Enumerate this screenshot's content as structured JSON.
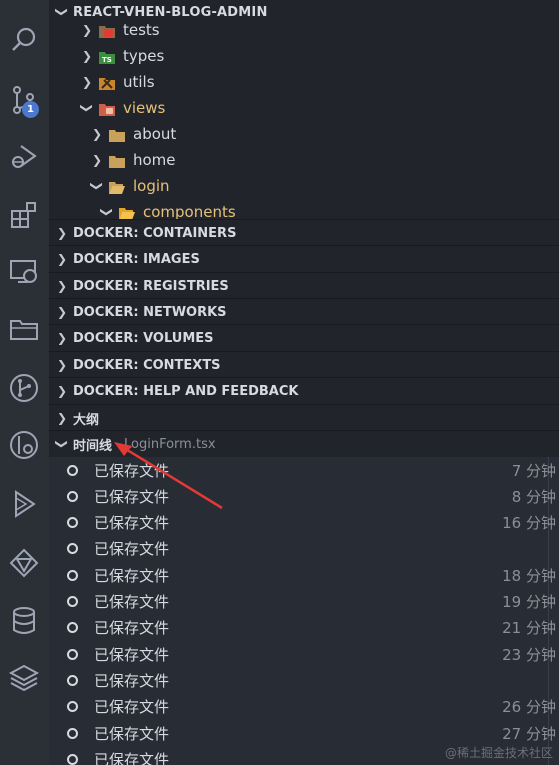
{
  "explorer": {
    "title": "REACT-VHEN-BLOG-ADMIN",
    "tree": [
      {
        "label": "tests",
        "icon": "tests-folder-icon",
        "expanded": false,
        "level": 0
      },
      {
        "label": "types",
        "icon": "typescript-folder-icon",
        "expanded": false,
        "level": 0
      },
      {
        "label": "utils",
        "icon": "utils-folder-icon",
        "expanded": false,
        "level": 0
      },
      {
        "label": "views",
        "icon": "views-folder-icon",
        "expanded": true,
        "level": 0,
        "modified": true
      },
      {
        "label": "about",
        "icon": "folder-icon",
        "expanded": false,
        "level": 1
      },
      {
        "label": "home",
        "icon": "folder-icon",
        "expanded": false,
        "level": 1
      },
      {
        "label": "login",
        "icon": "open-folder-icon",
        "expanded": true,
        "level": 1,
        "modified": true
      },
      {
        "label": "components",
        "icon": "components-folder-icon",
        "expanded": true,
        "level": 2,
        "modified": true
      }
    ]
  },
  "sections": [
    {
      "label": "DOCKER: CONTAINERS"
    },
    {
      "label": "DOCKER: IMAGES"
    },
    {
      "label": "DOCKER: REGISTRIES"
    },
    {
      "label": "DOCKER: NETWORKS"
    },
    {
      "label": "DOCKER: VOLUMES"
    },
    {
      "label": "DOCKER: CONTEXTS"
    },
    {
      "label": "DOCKER: HELP AND FEEDBACK"
    },
    {
      "label": "大纲"
    }
  ],
  "timeline": {
    "title": "时间线",
    "file": "LoginForm.tsx",
    "entries": [
      {
        "label": "已保存文件",
        "time": "7 分钟"
      },
      {
        "label": "已保存文件",
        "time": "8 分钟"
      },
      {
        "label": "已保存文件",
        "time": "16 分钟"
      },
      {
        "label": "已保存文件",
        "time": ""
      },
      {
        "label": "已保存文件",
        "time": "18 分钟"
      },
      {
        "label": "已保存文件",
        "time": "19 分钟"
      },
      {
        "label": "已保存文件",
        "time": "21 分钟"
      },
      {
        "label": "已保存文件",
        "time": "23 分钟"
      },
      {
        "label": "已保存文件",
        "time": ""
      },
      {
        "label": "已保存文件",
        "time": "26 分钟"
      },
      {
        "label": "已保存文件",
        "time": "27 分钟"
      },
      {
        "label": "已保存文件",
        "time": ""
      }
    ]
  },
  "activity_bar": {
    "scm_badge": "1",
    "icons": [
      "search-icon",
      "source-control-icon",
      "run-debug-icon",
      "extensions-icon",
      "remote-explorer-icon",
      "folder-icon",
      "git-graph-icon",
      "gitlens-icon",
      "docker-icon",
      "webpack-icon",
      "database-icon",
      "layers-icon"
    ]
  },
  "colors": {
    "accent_badge": "#4d78cc",
    "arrow": "#e53935",
    "modified": "#e5c07b"
  },
  "watermark": "@稀土掘金技术社区"
}
